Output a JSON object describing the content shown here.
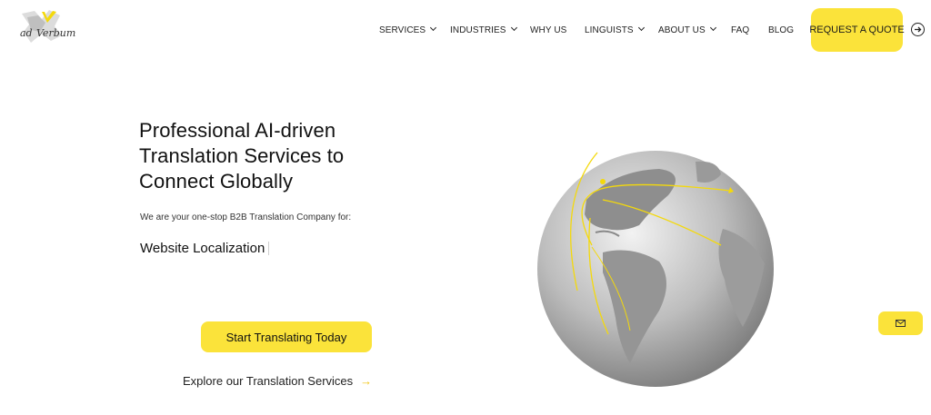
{
  "header": {
    "logo_text": "ad Verbum",
    "nav": [
      {
        "label": "SERVICES",
        "dropdown": true
      },
      {
        "label": "INDUSTRIES",
        "dropdown": true
      },
      {
        "label": "WHY US",
        "dropdown": false
      },
      {
        "label": "LINGUISTS",
        "dropdown": true
      },
      {
        "label": "ABOUT US",
        "dropdown": true
      },
      {
        "label": "FAQ",
        "dropdown": false
      },
      {
        "label": "BLOG",
        "dropdown": false
      }
    ],
    "cta_label": "REQUEST A QUOTE",
    "login_icon": "login-arrow-icon"
  },
  "hero": {
    "title": "Professional AI-driven Translation Services to Connect Globally",
    "subtitle": "We are your one-stop B2B Translation Company for:",
    "typed_text": "Website Localization",
    "primary_button": "Start Translating Today",
    "secondary_link": "Explore our Translation Services",
    "secondary_link_icon": "arrow-right-icon"
  },
  "floating": {
    "mail_icon": "envelope-icon"
  },
  "colors": {
    "accent": "#fbe33a",
    "text": "#111111"
  }
}
